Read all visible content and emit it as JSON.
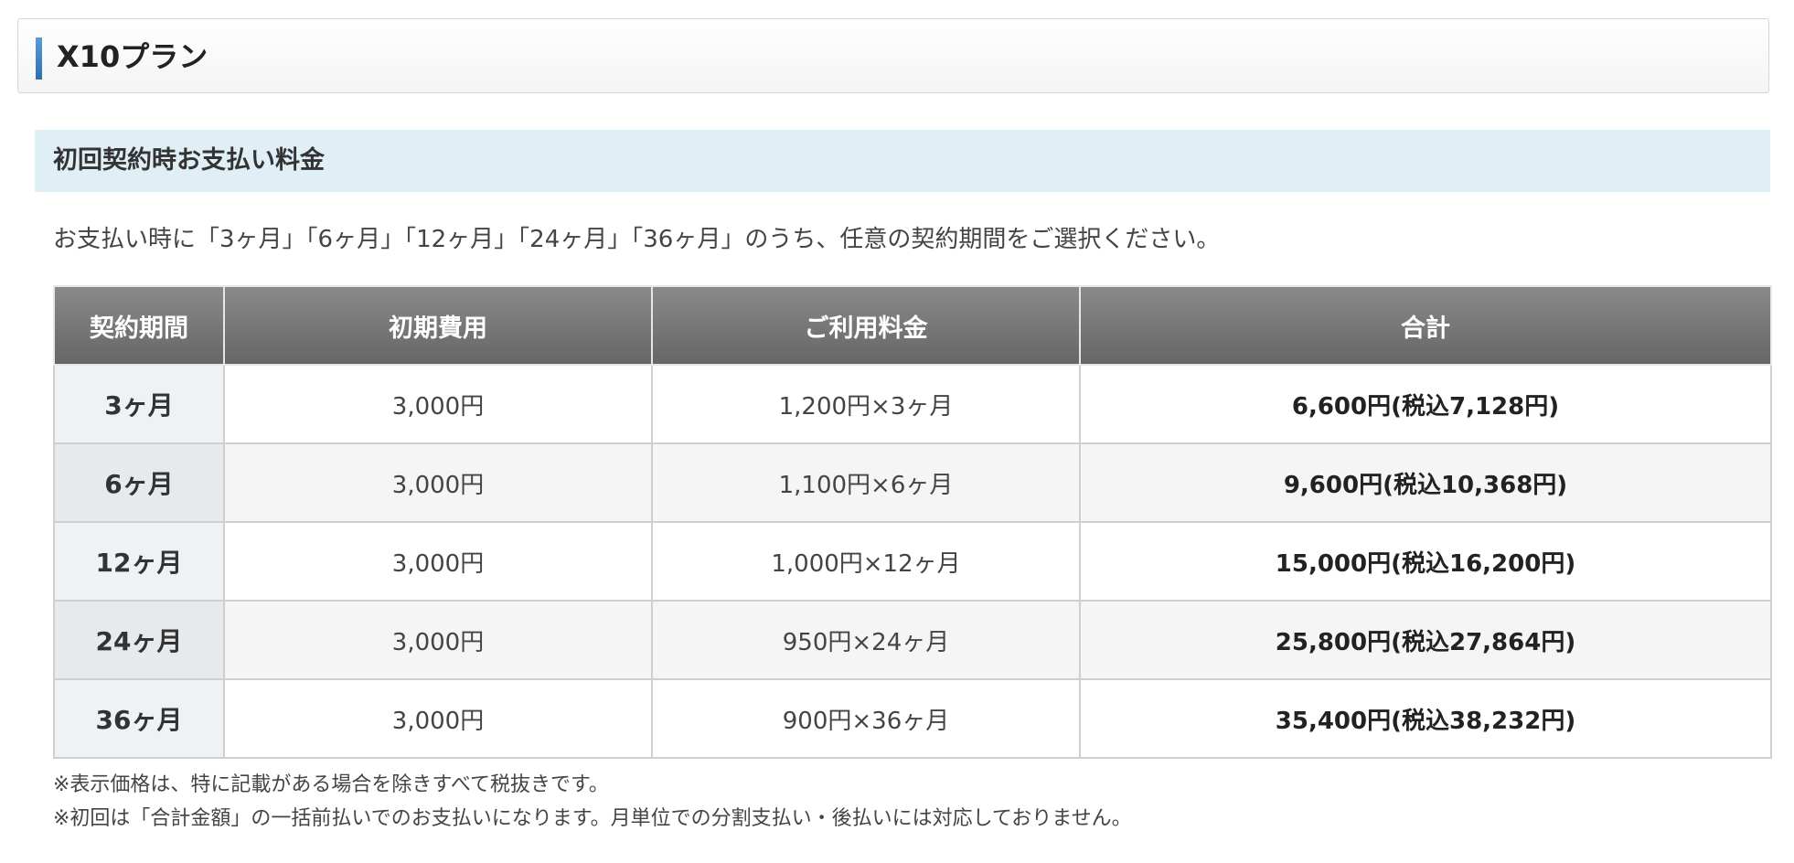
{
  "plan": {
    "title": "X10プラン"
  },
  "section": {
    "title": "初回契約時お支払い料金"
  },
  "intro": "お支払い時に「3ヶ月」「6ヶ月」「12ヶ月」「24ヶ月」「36ヶ月」のうち、任意の契約期間をご選択ください。",
  "table": {
    "headers": [
      "契約期間",
      "初期費用",
      "ご利用料金",
      "合計"
    ],
    "rows": [
      {
        "period": "3ヶ月",
        "initial_fee": "3,000円",
        "usage_fee": "1,200円×3ヶ月",
        "total": "6,600円(税込7,128円)"
      },
      {
        "period": "6ヶ月",
        "initial_fee": "3,000円",
        "usage_fee": "1,100円×6ヶ月",
        "total": "9,600円(税込10,368円)"
      },
      {
        "period": "12ヶ月",
        "initial_fee": "3,000円",
        "usage_fee": "1,000円×12ヶ月",
        "total": "15,000円(税込16,200円)"
      },
      {
        "period": "24ヶ月",
        "initial_fee": "3,000円",
        "usage_fee": "950円×24ヶ月",
        "total": "25,800円(税込27,864円)"
      },
      {
        "period": "36ヶ月",
        "initial_fee": "3,000円",
        "usage_fee": "900円×36ヶ月",
        "total": "35,400円(税込38,232円)"
      }
    ]
  },
  "notes": [
    "※表示価格は、特に記載がある場合を除きすべて税抜きです。",
    "※初回は「合計金額」の一括前払いでのお支払いになります。月単位での分割支払い・後払いには対応しておりません。"
  ],
  "colors": {
    "accent": "#2f6fb0",
    "section_bg": "#e0eef6",
    "table_header_bg": "#777777"
  }
}
